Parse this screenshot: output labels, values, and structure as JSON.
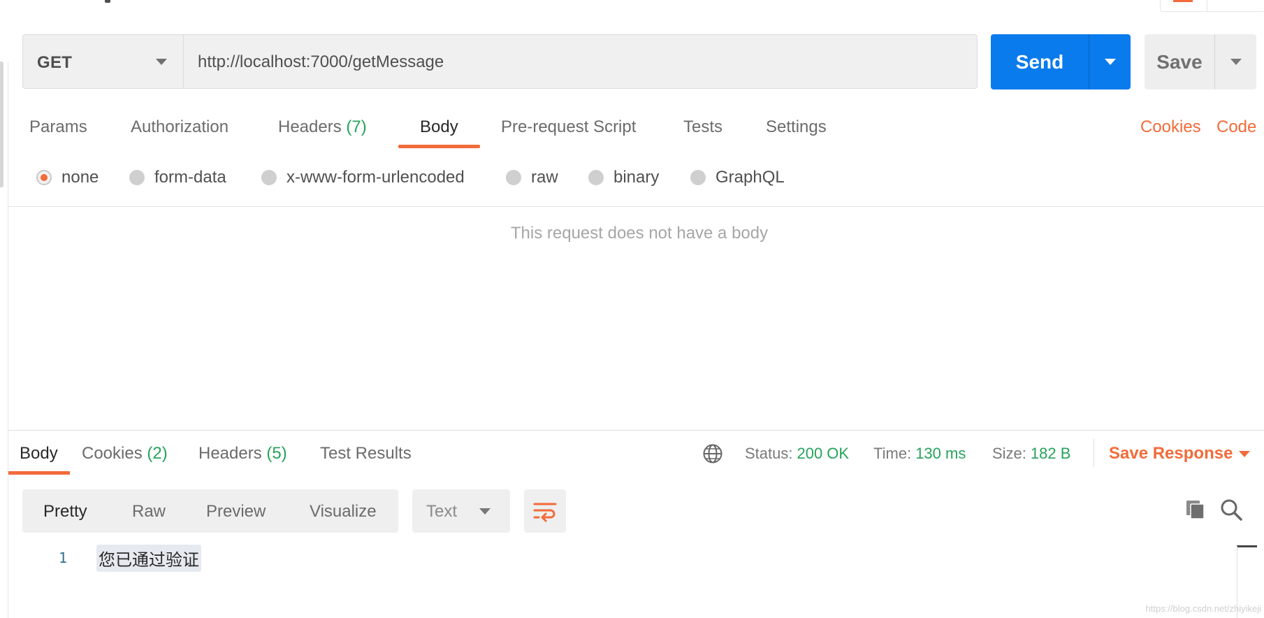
{
  "request": {
    "method": "GET",
    "url": "http://localhost:7000/getMessage",
    "send_label": "Send",
    "save_label": "Save"
  },
  "request_tabs": {
    "params": "Params",
    "authorization": "Authorization",
    "headers": "Headers",
    "headers_count": "(7)",
    "body": "Body",
    "prerequest": "Pre-request Script",
    "tests": "Tests",
    "settings": "Settings",
    "active": "Body"
  },
  "links": {
    "cookies": "Cookies",
    "code": "Code"
  },
  "body_types": {
    "selected": "none",
    "none": "none",
    "form_data": "form-data",
    "urlencoded": "x-www-form-urlencoded",
    "raw": "raw",
    "binary": "binary",
    "graphql": "GraphQL"
  },
  "empty_body_message": "This request does not have a body",
  "response_tabs": {
    "body": "Body",
    "cookies": "Cookies",
    "cookies_count": "(2)",
    "headers": "Headers",
    "headers_count": "(5)",
    "test_results": "Test Results",
    "active": "Body"
  },
  "response_meta": {
    "status_label": "Status:",
    "status_value": "200 OK",
    "time_label": "Time:",
    "time_value": "130 ms",
    "size_label": "Size:",
    "size_value": "182 B",
    "save_response": "Save Response"
  },
  "view_modes": {
    "pretty": "Pretty",
    "raw": "Raw",
    "preview": "Preview",
    "visualize": "Visualize",
    "active": "Pretty"
  },
  "format": "Text",
  "response_body": [
    {
      "line": "1",
      "text": "您已通过验证"
    }
  ],
  "watermark": "https://blog.csdn.net/zhiyikeji",
  "colors": {
    "accent": "#f26b3a",
    "primary": "#097bed",
    "success": "#26a35a"
  }
}
